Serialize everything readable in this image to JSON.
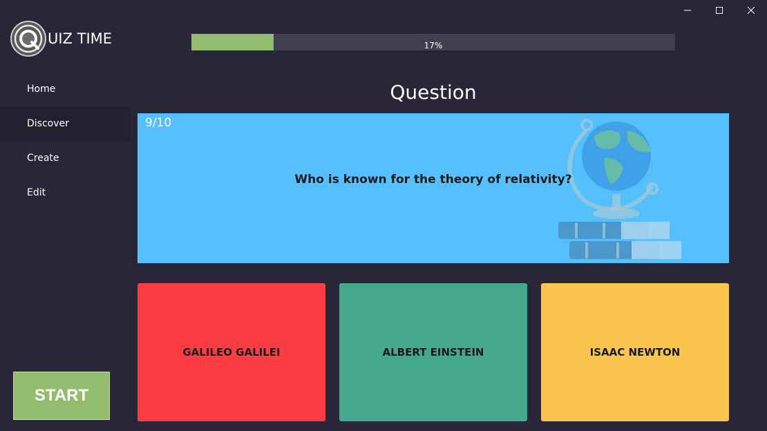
{
  "app": {
    "logo_letter": "Q",
    "logo_text": "UIZ TIME"
  },
  "window_controls": {
    "icons": [
      "minimize-icon",
      "maximize-icon",
      "close-icon"
    ]
  },
  "progress": {
    "value": 0.17,
    "label": "17%"
  },
  "sidebar": {
    "items": [
      {
        "label": "Home",
        "active": false
      },
      {
        "label": "Discover",
        "active": true
      },
      {
        "label": "Create",
        "active": false
      },
      {
        "label": "Edit",
        "active": false
      }
    ]
  },
  "start_button": {
    "label": "START"
  },
  "question": {
    "heading": "Question",
    "counter": "9/10",
    "text": "Who is known for the theory of relativity?",
    "illustration": "globe-on-books-icon"
  },
  "answers": [
    {
      "label": "GALILEO GALILEI",
      "color": "#fc3e44"
    },
    {
      "label": "ALBERT EINSTEIN",
      "color": "#43a98a"
    },
    {
      "label": "ISAAC NEWTON",
      "color": "#f9c54f"
    }
  ],
  "colors": {
    "background": "#282638",
    "accent_green": "#92bd6e",
    "question_card": "#56c0ff"
  }
}
